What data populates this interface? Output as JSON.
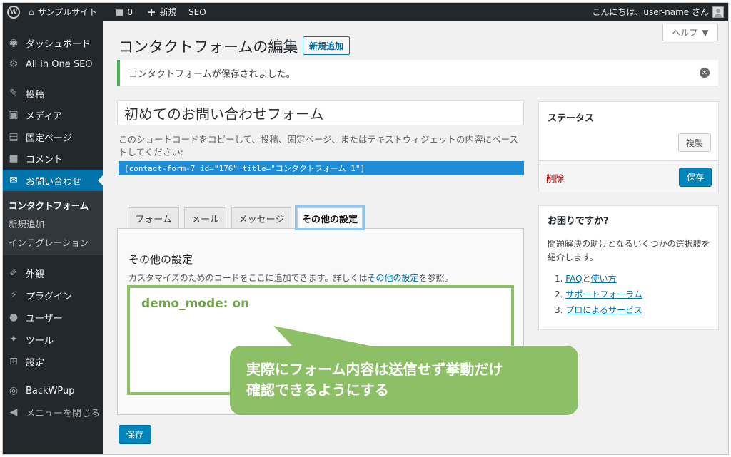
{
  "adminbar": {
    "site_name": "サンプルサイト",
    "comments_count": "0",
    "new_label": "新規",
    "seo_label": "SEO",
    "greeting": "こんにちは、user-name さん"
  },
  "sidebar": {
    "items": [
      {
        "label": "ダッシュボード",
        "icon": "dashboard-icon"
      },
      {
        "label": "All in One SEO",
        "icon": "gear-icon"
      },
      {
        "label": "投稿",
        "icon": "pin-icon"
      },
      {
        "label": "メディア",
        "icon": "media-icon"
      },
      {
        "label": "固定ページ",
        "icon": "page-icon"
      },
      {
        "label": "コメント",
        "icon": "comment-icon"
      },
      {
        "label": "お問い合わせ",
        "icon": "mail-icon"
      },
      {
        "label": "外観",
        "icon": "brush-icon"
      },
      {
        "label": "プラグイン",
        "icon": "plug-icon"
      },
      {
        "label": "ユーザー",
        "icon": "user-icon"
      },
      {
        "label": "ツール",
        "icon": "wrench-icon"
      },
      {
        "label": "設定",
        "icon": "settings-icon"
      },
      {
        "label": "BackWPup",
        "icon": "backwpup-icon"
      },
      {
        "label": "メニューを閉じる",
        "icon": "collapse-icon"
      }
    ],
    "submenu": [
      "コンタクトフォーム",
      "新規追加",
      "インテグレーション"
    ]
  },
  "main": {
    "help_label": "ヘルプ",
    "page_title": "コンタクトフォームの編集",
    "add_new_label": "新規追加",
    "notice": "コンタクトフォームが保存されました。",
    "form_title": "初めてのお問い合わせフォーム",
    "shortcode_hint": "このショートコードをコピーして、投稿、固定ページ、またはテキストウィジェットの内容にペーストしてください:",
    "shortcode": "[contact-form-7 id=\"176\" title=\"コンタクトフォーム 1\"]",
    "tabs": [
      "フォーム",
      "メール",
      "メッセージ",
      "その他の設定"
    ],
    "panel_heading": "その他の設定",
    "panel_desc_before": "カスタマイズのためのコードをここに追加できます。詳しくは",
    "panel_desc_link": "その他の設定",
    "panel_desc_after": "を参照。",
    "code_value": "demo_mode: on",
    "save_label": "保存"
  },
  "status_box": {
    "title": "ステータス",
    "duplicate_label": "複製",
    "delete_label": "削除",
    "save_label": "保存"
  },
  "help_box": {
    "title": "お困りですか?",
    "desc": "問題解決の助けとなるいくつかの選択肢を紹介します。",
    "item1_num": "1.",
    "item1_link_a": "FAQ",
    "item1_and": "と",
    "item1_link_b": "使い方",
    "item2_num": "2.",
    "item2_link": "サポートフォーラム",
    "item3_num": "3.",
    "item3_link": "プロによるサービス"
  },
  "callout": {
    "line1": "実際にフォーム内容は送信せず挙動だけ",
    "line2": "確認できるようにする"
  },
  "colors": {
    "admin_dark": "#23282d",
    "accent_blue": "#0073aa",
    "success_green": "#46b450",
    "callout_green": "#8dbf67"
  }
}
